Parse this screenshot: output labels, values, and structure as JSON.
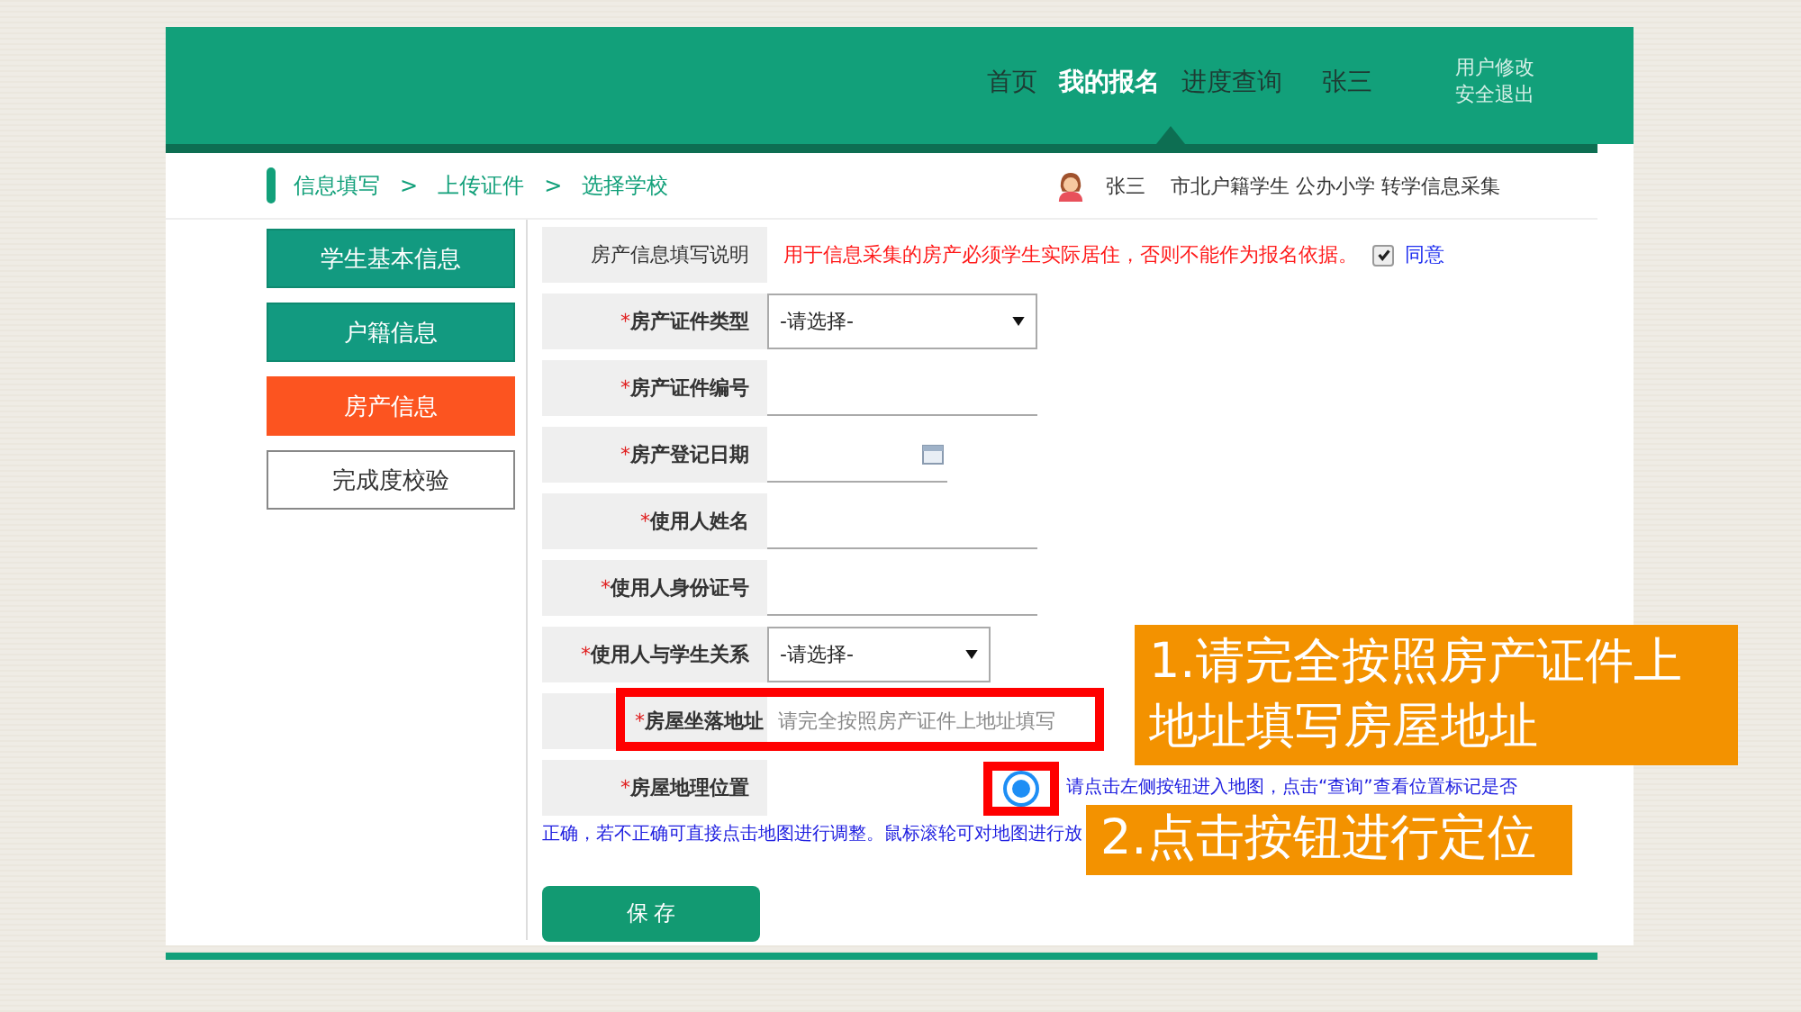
{
  "header": {
    "nav": [
      {
        "label": "首页",
        "selected": false
      },
      {
        "label": "我的报名",
        "selected": true
      },
      {
        "label": "进度查询",
        "selected": false
      }
    ],
    "user": "张三",
    "links": [
      "用户修改",
      "安全退出"
    ]
  },
  "breadcrumb": {
    "items": [
      "信息填写",
      "上传证件",
      "选择学校"
    ],
    "separator": ">"
  },
  "profile": {
    "name": "张三",
    "description": "市北户籍学生 公办小学 转学信息采集"
  },
  "sidebar": [
    {
      "label": "学生基本信息",
      "selected": false,
      "completed": true
    },
    {
      "label": "户籍信息",
      "selected": false,
      "completed": true
    },
    {
      "label": "房产信息",
      "selected": true,
      "completed": false
    },
    {
      "label": "完成度校验",
      "selected": false,
      "completed": false
    }
  ],
  "form": {
    "rows": [
      {
        "kind": "note",
        "label": "房产信息填写说明",
        "text": "用于信息采集的房产必须学生实际居住，否则不能作为报名依据。",
        "agree": {
          "label": "同意",
          "checked": true
        }
      },
      {
        "kind": "select",
        "mark": "*",
        "label": "房产证件类型",
        "value": "-请选择-"
      },
      {
        "kind": "input",
        "mark": "*",
        "label": "房产证件编号"
      },
      {
        "kind": "date",
        "mark": "*",
        "label": "房产登记日期"
      },
      {
        "kind": "input",
        "mark": "*",
        "label": "使用人姓名"
      },
      {
        "kind": "input",
        "mark": "*",
        "label": "使用人身份证号"
      },
      {
        "kind": "select",
        "mark": "*",
        "label": "使用人与学生关系",
        "value": "-请选择-"
      },
      {
        "kind": "input",
        "mark": "*",
        "label": "房屋坐落地址",
        "placeholder": "请完全按照房产证件上地址填写",
        "highlighted": true
      },
      {
        "kind": "locate",
        "mark": "*",
        "label": "房屋地理位置",
        "help": [
          "请点击左侧按钮进入地图，点击“查询”查看位置标记是否",
          "正确，若不正确可直接点击地图进行调整。鼠标滚轮可对地图进行放"
        ],
        "highlighted": true
      }
    ],
    "save": "保 存"
  },
  "callouts": [
    "1.请完全按照房产证件上地址填写房屋地址",
    "2.点击按钮进行定位"
  ]
}
